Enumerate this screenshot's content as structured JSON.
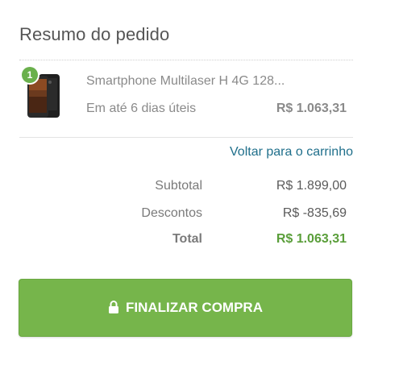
{
  "summary": {
    "title": "Resumo do pedido"
  },
  "item": {
    "quantity": "1",
    "name": "Smartphone Multilaser H 4G 128...",
    "delivery": "Em até 6 dias úteis",
    "price": "R$ 1.063,31",
    "thumbnail_icon": "smartphone-product-image"
  },
  "links": {
    "back_to_cart": "Voltar para o carrinho"
  },
  "totals": {
    "subtotal_label": "Subtotal",
    "subtotal_value": "R$ 1.899,00",
    "discount_label": "Descontos",
    "discount_value": "R$ -835,69",
    "total_label": "Total",
    "total_value": "R$ 1.063,31"
  },
  "checkout": {
    "button_label": "FINALIZAR COMPRA",
    "icon": "lock-icon"
  },
  "colors": {
    "accent_green": "#76b54b",
    "link_blue": "#1f6f8b",
    "total_green": "#5a9e3a"
  }
}
